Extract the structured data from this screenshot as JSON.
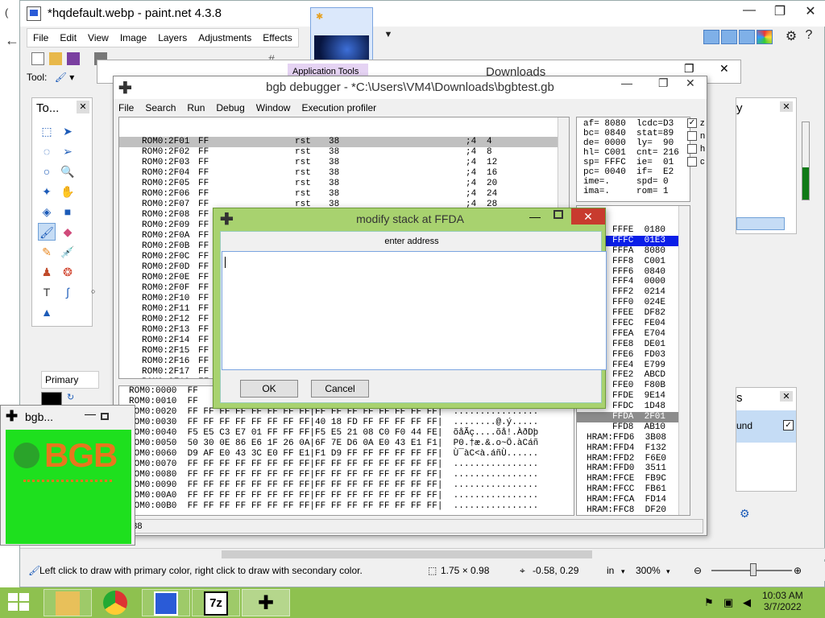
{
  "desktop": {
    "left_letter": "(",
    "back_arrow": "←"
  },
  "pdn": {
    "title": "*hqdefault.webp - paint.net 4.3.8",
    "menu": [
      "File",
      "Edit",
      "View",
      "Image",
      "Layers",
      "Adjustments",
      "Effects"
    ],
    "tool_label": "Tool:",
    "tools_panel_title": "To...",
    "primary_label": "Primary",
    "right_panel_letter": "y",
    "layers_letter": "s",
    "layers_item_text": "und",
    "status": {
      "hint": "Left click to draw with primary color, right click to draw with secondary color.",
      "size": "1.75 × 0.98",
      "coords": "-0.58, 0.29",
      "units": "in",
      "zoom": "300%"
    }
  },
  "downloads": {
    "app_tools": "Application Tools",
    "title": "Downloads"
  },
  "debugger": {
    "title": "bgb debugger - *C:\\Users\\VM4\\Downloads\\bgbtest.gb",
    "menu": [
      "File",
      "Search",
      "Run",
      "Debug",
      "Window",
      "Execution profiler"
    ],
    "code_rows": [
      {
        "addr": "ROM0:2F01",
        "op": "FF",
        "mn": "rst",
        "arg": "38",
        "cyc": ";4",
        "t": "4"
      },
      {
        "addr": "ROM0:2F02",
        "op": "FF",
        "mn": "rst",
        "arg": "38",
        "cyc": ";4",
        "t": "8"
      },
      {
        "addr": "ROM0:2F03",
        "op": "FF",
        "mn": "rst",
        "arg": "38",
        "cyc": ";4",
        "t": "12"
      },
      {
        "addr": "ROM0:2F04",
        "op": "FF",
        "mn": "rst",
        "arg": "38",
        "cyc": ";4",
        "t": "16"
      },
      {
        "addr": "ROM0:2F05",
        "op": "FF",
        "mn": "rst",
        "arg": "38",
        "cyc": ";4",
        "t": "20"
      },
      {
        "addr": "ROM0:2F06",
        "op": "FF",
        "mn": "rst",
        "arg": "38",
        "cyc": ";4",
        "t": "24"
      },
      {
        "addr": "ROM0:2F07",
        "op": "FF",
        "mn": "rst",
        "arg": "38",
        "cyc": ";4",
        "t": "28"
      },
      {
        "addr": "ROM0:2F08",
        "op": "FF",
        "mn": "rst",
        "arg": "38",
        "cyc": ";4",
        "t": "32"
      },
      {
        "addr": "ROM0:2F09",
        "op": "FF",
        "mn": "",
        "arg": "",
        "cyc": "",
        "t": ""
      },
      {
        "addr": "ROM0:2F0A",
        "op": "FF",
        "mn": "",
        "arg": "",
        "cyc": "",
        "t": ""
      },
      {
        "addr": "ROM0:2F0B",
        "op": "FF",
        "mn": "",
        "arg": "",
        "cyc": "",
        "t": ""
      },
      {
        "addr": "ROM0:2F0C",
        "op": "FF",
        "mn": "",
        "arg": "",
        "cyc": "",
        "t": ""
      },
      {
        "addr": "ROM0:2F0D",
        "op": "FF",
        "mn": "",
        "arg": "",
        "cyc": "",
        "t": ""
      },
      {
        "addr": "ROM0:2F0E",
        "op": "FF",
        "mn": "",
        "arg": "",
        "cyc": "",
        "t": ""
      },
      {
        "addr": "ROM0:2F0F",
        "op": "FF",
        "mn": "",
        "arg": "",
        "cyc": "",
        "t": ""
      },
      {
        "addr": "ROM0:2F10",
        "op": "FF",
        "mn": "",
        "arg": "",
        "cyc": "",
        "t": ""
      },
      {
        "addr": "ROM0:2F11",
        "op": "FF",
        "mn": "",
        "arg": "",
        "cyc": "",
        "t": ""
      },
      {
        "addr": "ROM0:2F12",
        "op": "FF",
        "mn": "",
        "arg": "",
        "cyc": "",
        "t": ""
      },
      {
        "addr": "ROM0:2F13",
        "op": "FF",
        "mn": "",
        "arg": "",
        "cyc": "",
        "t": ""
      },
      {
        "addr": "ROM0:2F14",
        "op": "FF",
        "mn": "",
        "arg": "",
        "cyc": "",
        "t": ""
      },
      {
        "addr": "ROM0:2F15",
        "op": "FF",
        "mn": "",
        "arg": "",
        "cyc": "",
        "t": ""
      },
      {
        "addr": "ROM0:2F16",
        "op": "FF",
        "mn": "",
        "arg": "",
        "cyc": "",
        "t": ""
      },
      {
        "addr": "ROM0:2F17",
        "op": "FF",
        "mn": "",
        "arg": "",
        "cyc": "",
        "t": ""
      },
      {
        "addr": "ROM0:2F18",
        "op": "FF",
        "mn": "",
        "arg": "",
        "cyc": "",
        "t": ""
      },
      {
        "addr": "ROM0:2F19",
        "op": "FF",
        "mn": "",
        "arg": "",
        "cyc": "",
        "t": ""
      }
    ],
    "mem_rows": [
      "ROM0:0000  FF",
      "ROM0:0010  FF",
      "ROM0:0020  FF FF FF FF FF FF FF FF|FF FF FF FF FF FF FF FF|  ................",
      "ROM0:0030  FF FF FF FF FF FF FF FF|40 18 FD FF FF FF FF FF|  ........@.ý.....",
      "ROM0:0040  F5 E5 C3 E7 01 FF FF FF|F5 E5 21 08 C0 F0 44 FE|  õåÃç....õå!.ÀðDþ",
      "ROM0:0050  50 30 0E 86 E6 1F 26 0A|6F 7E D6 0A E0 43 E1 F1|  P0.†æ.&.o~Ö.àCáñ",
      "ROM0:0060  D9 AF E0 43 3C E0 FF E1|F1 D9 FF FF FF FF FF FF|  Ù¯àC<à.áñÙ......",
      "ROM0:0070  FF FF FF FF FF FF FF FF|FF FF FF FF FF FF FF FF|  ................",
      "ROM0:0080  FF FF FF FF FF FF FF FF|FF FF FF FF FF FF FF FF|  ................",
      "ROM0:0090  FF FF FF FF FF FF FF FF|FF FF FF FF FF FF FF FF|  ................",
      "ROM0:00A0  FF FF FF FF FF FF FF FF|FF FF FF FF FF FF FF FF|  ................",
      "ROM0:00B0  FF FF FF FF FF FF FF FF|FF FF FF FF FF FF FF FF|  ................"
    ],
    "regs": [
      "af= 8080  lcdc=D3",
      "bc= 0840  stat=89",
      "de= 0000  ly=  90",
      "hl= C001  cnt= 216",
      "sp= FFFC  ie=  01",
      "pc= 0040  if=  E2",
      "ime=.     spd= 0",
      "ima=.     rom= 1"
    ],
    "flags": [
      "z",
      "n",
      "h",
      "c"
    ],
    "stack_rows": [
      {
        "t": "FFFE  0180",
        "s": ""
      },
      {
        "t": "FFFC  01E3",
        "s": "hi"
      },
      {
        "t": "FFFA  8080",
        "s": ""
      },
      {
        "t": "FFF8  C001",
        "s": ""
      },
      {
        "t": "FFF6  0840",
        "s": ""
      },
      {
        "t": "FFF4  0000",
        "s": ""
      },
      {
        "t": "FFF2  0214",
        "s": ""
      },
      {
        "t": "FFF0  024E",
        "s": ""
      },
      {
        "t": "FFEE  DF82",
        "s": ""
      },
      {
        "t": "FFEC  FE04",
        "s": ""
      },
      {
        "t": "FFEA  E704",
        "s": ""
      },
      {
        "t": "FFE8  DE01",
        "s": ""
      },
      {
        "t": "FFE6  FD03",
        "s": ""
      },
      {
        "t": "FFE4  E799",
        "s": ""
      },
      {
        "t": "FFE2  ABCD",
        "s": ""
      },
      {
        "t": "FFE0  F80B",
        "s": ""
      },
      {
        "t": "FFDE  9E14",
        "s": ""
      },
      {
        "t": "FFDC  1D48",
        "s": ""
      },
      {
        "t": "FFDA  2F01",
        "s": "gr"
      },
      {
        "t": "FFD8  AB10",
        "s": ""
      },
      {
        "t": "HRAM:FFD6  3B08",
        "s": "h"
      },
      {
        "t": "HRAM:FFD4  F132",
        "s": "h"
      },
      {
        "t": "HRAM:FFD2  F6E0",
        "s": "h"
      },
      {
        "t": "HRAM:FFD0  3511",
        "s": "h"
      },
      {
        "t": "HRAM:FFCE  FB9C",
        "s": "h"
      },
      {
        "t": "HRAM:FFCC  FB61",
        "s": "h"
      },
      {
        "t": "HRAM:FFCA  FD14",
        "s": "h"
      },
      {
        "t": "HRAM:FFC8  DF20",
        "s": "h"
      },
      {
        "t": "HRAM:FFC6  A55C",
        "s": "h"
      },
      {
        "t": "HRAM:FFC4  8F46",
        "s": "h"
      }
    ],
    "status": "0038"
  },
  "dialog": {
    "title": "modify stack at FFDA",
    "label": "enter address",
    "value": "",
    "ok": "OK",
    "cancel": "Cancel"
  },
  "mini_bgb": {
    "title": "bgb...",
    "logo": "BGB"
  },
  "taskbar": {
    "time": "10:03 AM",
    "date": "3/7/2022",
    "apps": [
      "file-explorer",
      "chrome",
      "paint-net",
      "7zip",
      "bgb"
    ]
  }
}
